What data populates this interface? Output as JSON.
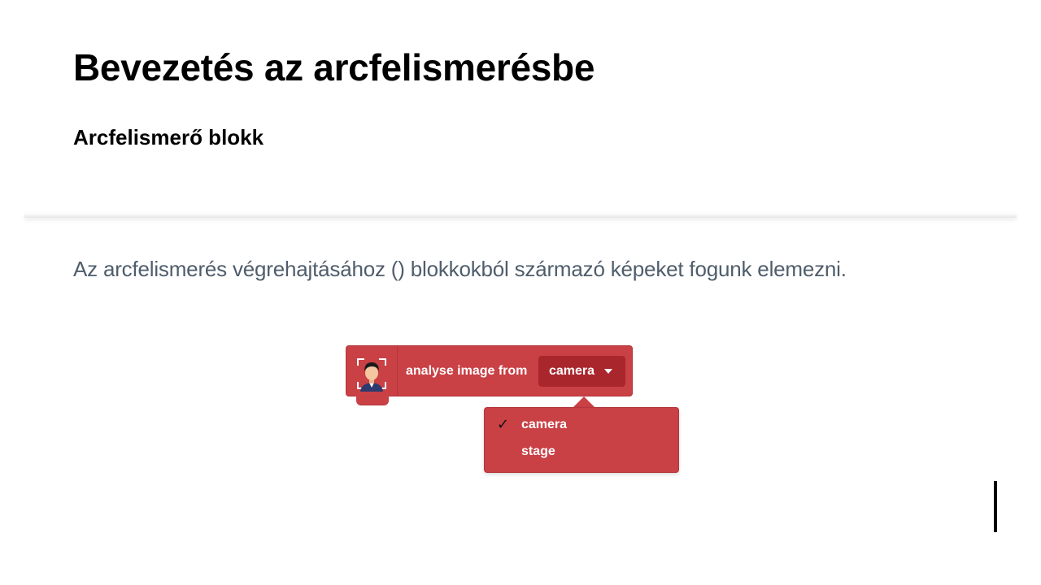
{
  "slide": {
    "title": "Bevezetés az arcfelismerésbe",
    "subtitle": "Arcfelismerő blokk",
    "body": "Az arcfelismerés végrehajtásához () blokkokból származó képeket fogunk elemezni."
  },
  "block": {
    "label": "analyse image from",
    "selected": "camera",
    "color": "#c94045",
    "field_color": "#a9262d",
    "icon": "face-recognition-icon"
  },
  "menu": {
    "items": [
      {
        "label": "camera",
        "checked": true
      },
      {
        "label": "stage",
        "checked": false
      }
    ],
    "check_glyph": "✓"
  }
}
